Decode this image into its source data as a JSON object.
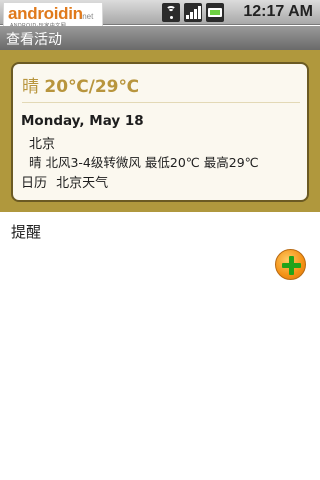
{
  "statusbar": {
    "logo_main": "androidin",
    "logo_suffix": ".net",
    "logo_tagline": "ANDROID·玩家中文网",
    "time": "12:17 AM",
    "icons": [
      "wifi-icon",
      "signal-icon",
      "battery-icon"
    ],
    "battery_color": "#6ed043"
  },
  "titlebar": {
    "title": "查看活动"
  },
  "event_card": {
    "weather_prefix": "晴 ",
    "temperature": "20℃/29℃",
    "date": "Monday, May 18",
    "city": "北京",
    "detail": "晴 北风3-4级转微风 最低20℃ 最高29℃",
    "calendar_link": "日历",
    "weather_link": "北京天气",
    "accent_color": "#b8953d"
  },
  "reminders": {
    "label": "提醒",
    "add_icon": "plus-icon"
  }
}
